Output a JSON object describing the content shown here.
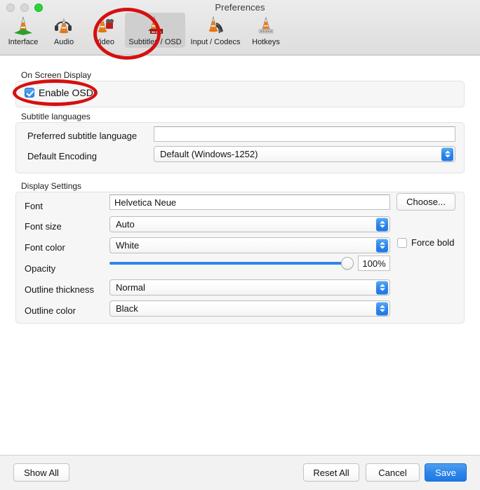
{
  "window": {
    "title": "Preferences",
    "controls": [
      {
        "name": "close-button",
        "color": "#d6d6d6"
      },
      {
        "name": "minimize-button",
        "color": "#d6d6d6"
      },
      {
        "name": "zoom-button",
        "color": "#2ad438"
      }
    ]
  },
  "toolbar": {
    "items": [
      {
        "id": "interface",
        "label": "Interface",
        "icon": "vlc-cone-interface-icon",
        "selected": false
      },
      {
        "id": "audio",
        "label": "Audio",
        "icon": "vlc-cone-audio-icon",
        "selected": false
      },
      {
        "id": "video",
        "label": "Video",
        "icon": "vlc-cone-video-icon",
        "selected": false
      },
      {
        "id": "subtitles-osd",
        "label": "Subtitles / OSD",
        "icon": "vlc-cone-subtitles-icon",
        "selected": true
      },
      {
        "id": "input-codecs",
        "label": "Input / Codecs",
        "icon": "vlc-cone-input-icon",
        "selected": false
      },
      {
        "id": "hotkeys",
        "label": "Hotkeys",
        "icon": "vlc-cone-hotkeys-icon",
        "selected": false
      }
    ]
  },
  "groups": {
    "osd": {
      "label": "On Screen Display"
    },
    "subtitle_languages": {
      "label": "Subtitle languages"
    },
    "display_settings": {
      "label": "Display Settings"
    }
  },
  "osd": {
    "enable_osd_label": "Enable OSD",
    "enable_osd_checked": true
  },
  "subtitle_languages": {
    "preferred_label": "Preferred subtitle language",
    "preferred_value": "",
    "preferred_placeholder": "",
    "encoding_label": "Default Encoding",
    "encoding_value": "Default (Windows-1252)"
  },
  "display_settings": {
    "font_label": "Font",
    "font_value": "Helvetica Neue",
    "choose_button": "Choose...",
    "font_size_label": "Font size",
    "font_size_value": "Auto",
    "font_color_label": "Font color",
    "font_color_value": "White",
    "force_bold_label": "Force bold",
    "force_bold_checked": false,
    "opacity_label": "Opacity",
    "opacity_value": "100%",
    "opacity_percent": 100,
    "outline_thickness_label": "Outline thickness",
    "outline_thickness_value": "Normal",
    "outline_color_label": "Outline color",
    "outline_color_value": "Black"
  },
  "footer": {
    "show_all": "Show All",
    "reset_all": "Reset All",
    "cancel": "Cancel",
    "save": "Save"
  },
  "annotations": {
    "color": "#d51010",
    "highlights": [
      {
        "name": "annotation-circle-subtitles-tab"
      },
      {
        "name": "annotation-circle-enable-osd"
      }
    ]
  },
  "colors": {
    "accent_blue": "#2f86e9",
    "annotation_red": "#d51010",
    "panel_bg": "#f6f6f6",
    "toolbar_bg": "#e3e3e4"
  }
}
